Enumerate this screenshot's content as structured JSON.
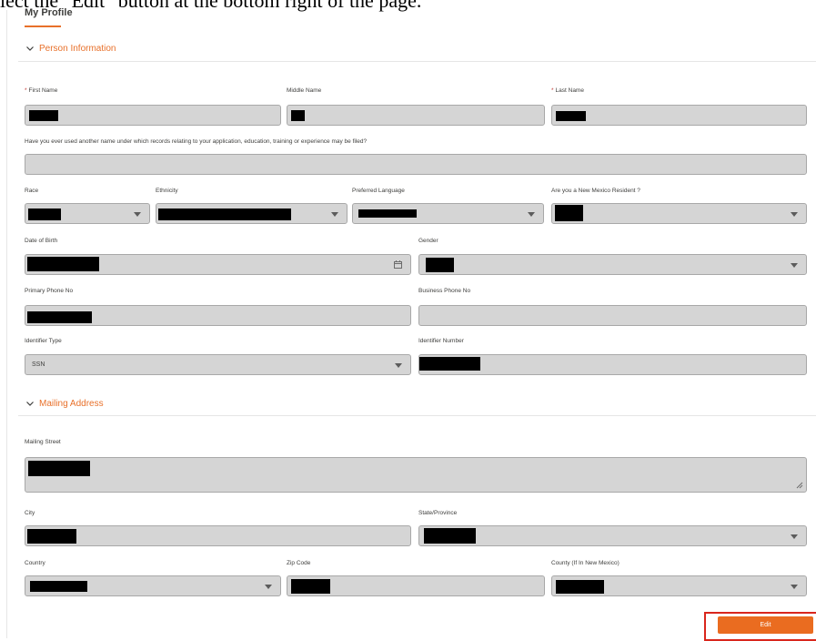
{
  "instruction": "lect the \"Edit\" button at the bottom right of the page.",
  "page_title": "My Profile",
  "sections": {
    "person": {
      "title": "Person Information"
    },
    "mailing": {
      "title": "Mailing Address"
    }
  },
  "labels": {
    "first_name": "First Name",
    "middle_name": "Middle Name",
    "last_name": "Last Name",
    "other_names": "Have you ever used another name under which records relating to your application, education, training or experience may be filed?",
    "race": "Race",
    "ethnicity": "Ethnicity",
    "preferred_language": "Preferred Language",
    "nm_resident": "Are you a New Mexico Resident ?",
    "date_of_birth": "Date of Birth",
    "gender": "Gender",
    "primary_phone": "Primary Phone No",
    "business_phone": "Business Phone No",
    "identifier_type": "Identifier Type",
    "identifier_number": "Identifier Number",
    "mailing_street": "Mailing Street",
    "city": "City",
    "state_province": "State/Province",
    "country": "Country",
    "zip_code": "Zip Code",
    "county": "County (If In New Mexico)"
  },
  "required_marker": "*",
  "values": {
    "identifier_type": "SSN"
  },
  "buttons": {
    "edit": "Edit"
  },
  "colors": {
    "accent": "#e8702a",
    "button": "#ea6c20",
    "highlight": "#d9261c",
    "field_bg": "#d5d5d5"
  },
  "icons": {
    "section_toggle": "chevron-down-icon",
    "dropdown": "caret-down-icon",
    "date_picker": "calendar-icon"
  }
}
